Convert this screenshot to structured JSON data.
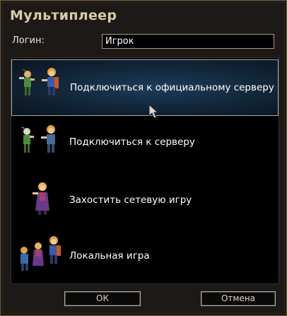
{
  "window": {
    "title": "Мультиплеер"
  },
  "login": {
    "label": "Логин:",
    "value": "Игрок"
  },
  "options": [
    {
      "label": "Подключиться к официальному серверу",
      "icon": "two-warriors-icon",
      "selected": true
    },
    {
      "label": "Подключиться к серверу",
      "icon": "two-warriors-icon",
      "selected": false
    },
    {
      "label": "Захостить сетевую игру",
      "icon": "mage-icon",
      "selected": false
    },
    {
      "label": "Локальная игра",
      "icon": "party-icon",
      "selected": false
    }
  ],
  "buttons": {
    "ok": "ОК",
    "cancel": "Отмена"
  },
  "colors": {
    "accent_title": "#d9cca6",
    "selection": "#122538",
    "border": "#a79a82"
  }
}
